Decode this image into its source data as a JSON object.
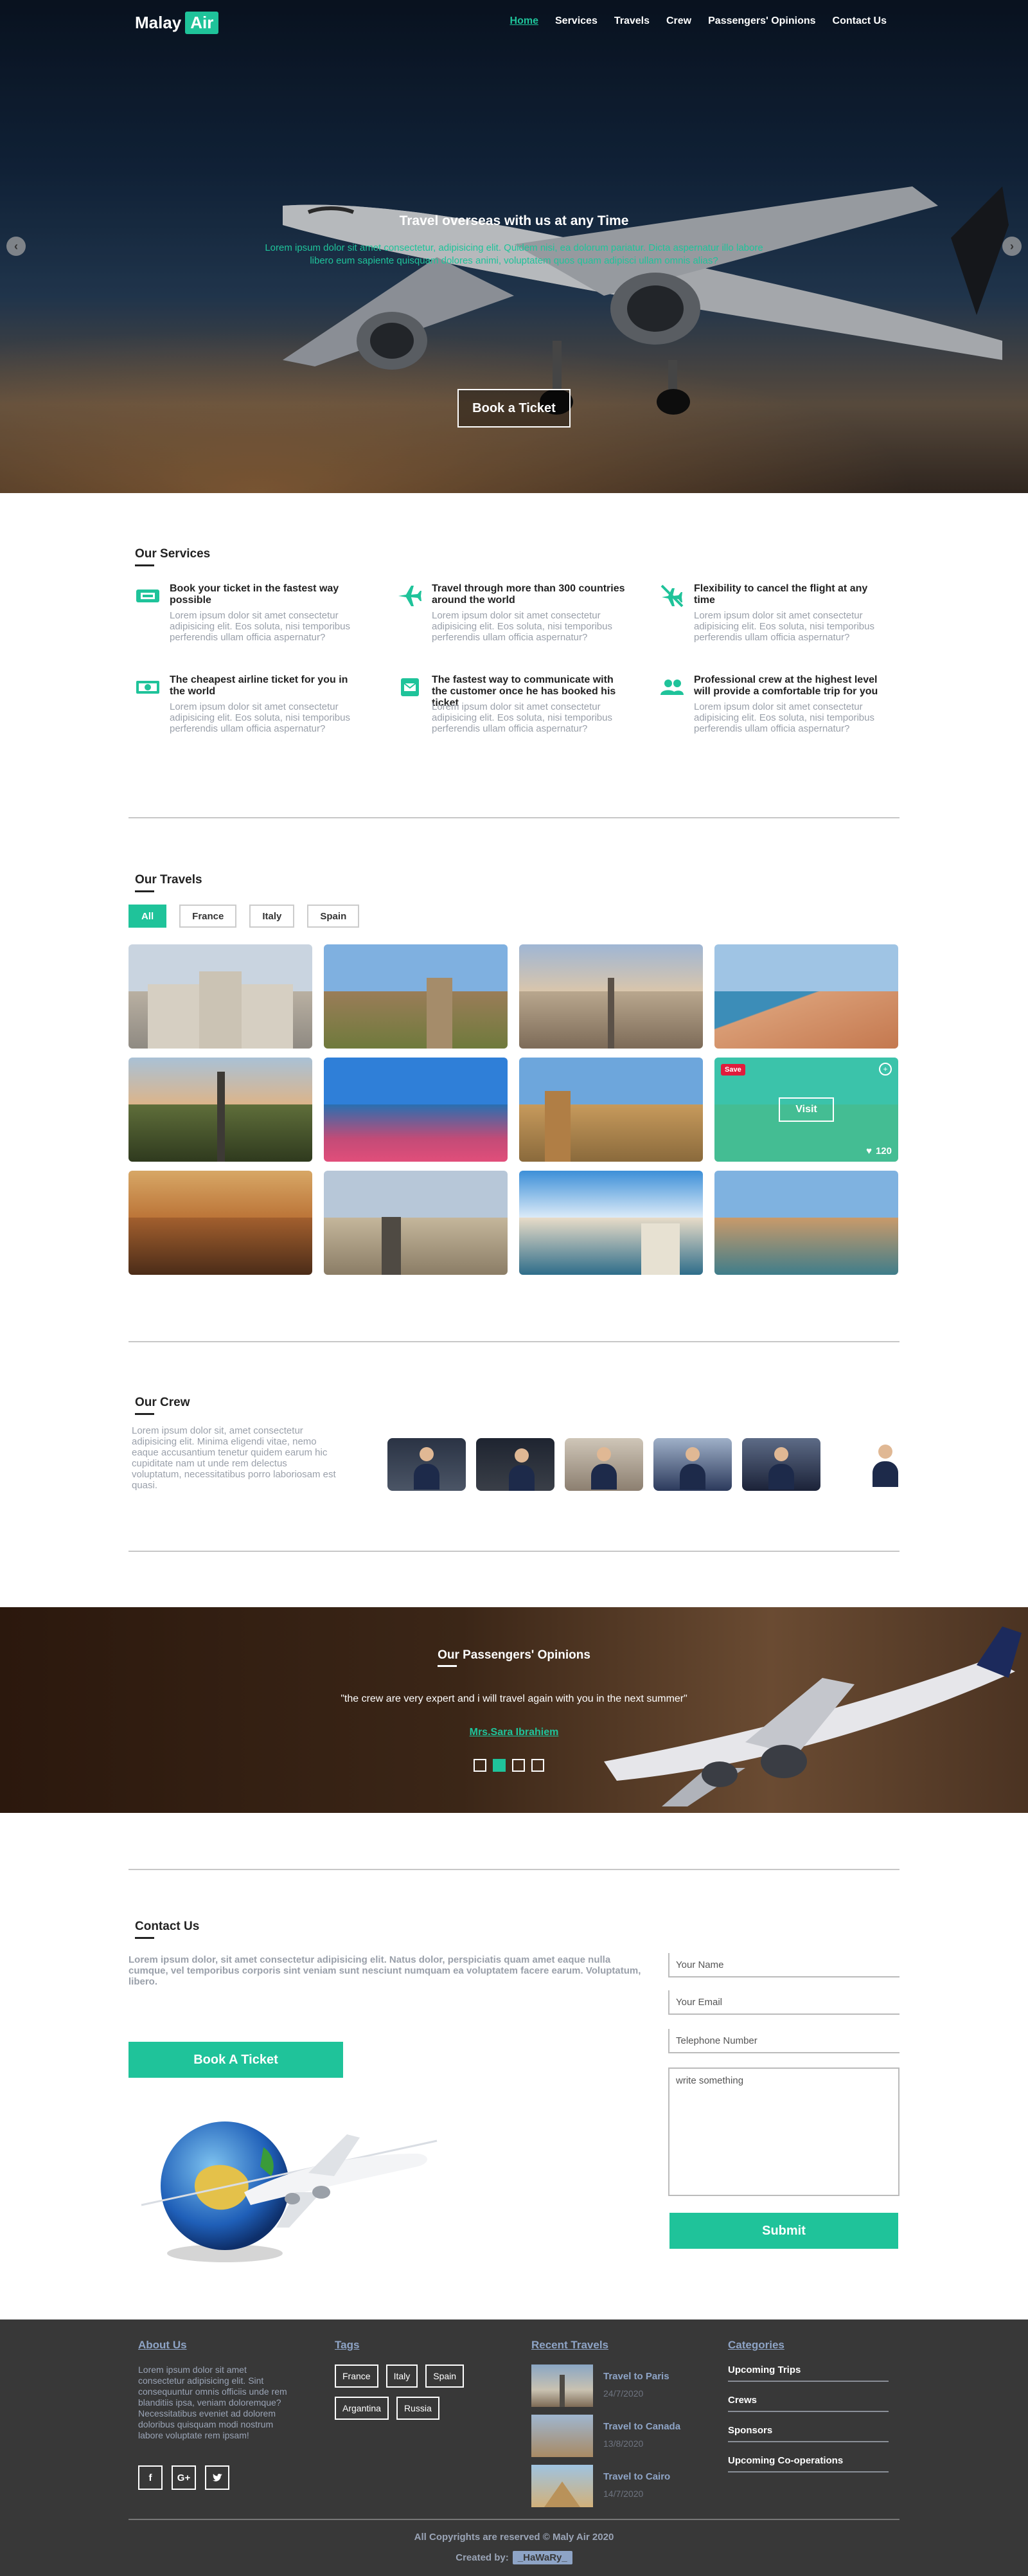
{
  "brand": {
    "name": "Malay",
    "accent": "Air",
    "accent_color": "#1fc39a"
  },
  "nav": [
    {
      "label": "Home",
      "active": true
    },
    {
      "label": "Services"
    },
    {
      "label": "Travels"
    },
    {
      "label": "Crew"
    },
    {
      "label": "Passengers' Opinions"
    },
    {
      "label": "Contact Us"
    }
  ],
  "hero": {
    "title": "Travel overseas with us at any Time",
    "text": "Lorem ipsum dolor sit amet consectetur, adipisicing elit. Quidem nisi, ea dolorum pariatur. Dicta aspernatur illo labore libero eum sapiente quisquam dolores animi, voluptatem quos quam adipisci ullam omnis alias?",
    "button": "Book a Ticket",
    "prev_icon": "chevron-left-icon",
    "next_icon": "chevron-right-icon"
  },
  "services": {
    "title": "Our Services",
    "items": [
      {
        "icon": "ticket-icon",
        "title": "Book your ticket in the fastest way possible",
        "text": "Lorem ipsum dolor sit amet consectetur adipisicing elit. Eos soluta, nisi temporibus perferendis ullam officia aspernatur?"
      },
      {
        "icon": "plane-icon",
        "title": "Travel through more than 300 countries around the world",
        "text": "Lorem ipsum dolor sit amet consectetur adipisicing elit. Eos soluta, nisi temporibus perferendis ullam officia aspernatur?"
      },
      {
        "icon": "plane-slash-icon",
        "title": "Flexibility to cancel the flight at any time",
        "text": "Lorem ipsum dolor sit amet consectetur adipisicing elit. Eos soluta, nisi temporibus perferendis ullam officia aspernatur?"
      },
      {
        "icon": "money-icon",
        "title": "The cheapest airline ticket for you in the world",
        "text": "Lorem ipsum dolor sit amet consectetur adipisicing elit. Eos soluta, nisi temporibus perferendis ullam officia aspernatur?"
      },
      {
        "icon": "envelope-icon",
        "title": "The fastest way to communicate with the customer once he has booked his ticket",
        "text": "Lorem ipsum dolor sit amet consectetur adipisicing elit. Eos soluta, nisi temporibus perferendis ullam officia aspernatur?"
      },
      {
        "icon": "users-icon",
        "title": "Professional crew at the highest level will provide a comfortable trip for you",
        "text": "Lorem ipsum dolor sit amet consectetur adipisicing elit. Eos soluta, nisi temporibus perferendis ullam officia aspernatur?"
      }
    ]
  },
  "travels": {
    "title": "Our Travels",
    "filters": [
      {
        "label": "All",
        "active": true
      },
      {
        "label": "France"
      },
      {
        "label": "Italy"
      },
      {
        "label": "Spain"
      }
    ],
    "hover_tile": {
      "save": "Save",
      "visit": "Visit",
      "likes": "120"
    }
  },
  "crew": {
    "title": "Our Crew",
    "text": "Lorem ipsum dolor sit, amet consectetur adipisicing elit. Minima eligendi vitae, nemo eaque accusantium tenetur quidem earum hic cupiditate nam ut unde rem delectus voluptatum, necessitatibus porro laboriosam est quasi."
  },
  "opinions": {
    "title": "Our Passengers' Opinions",
    "quote": "\"the crew are very expert and i will travel again with you in the next summer\"",
    "author": "Mrs.Sara Ibrahiem",
    "active_slide": 2,
    "slides": 4
  },
  "contact": {
    "title": "Contact Us",
    "text": "Lorem ipsum dolor, sit amet consectetur adipisicing elit. Natus dolor, perspiciatis quam amet eaque nulla cumque, vel temporibus corporis sint veniam sunt nesciunt numquam ea voluptatem facere earum. Voluptatum, libero.",
    "book_button": "Book A Ticket",
    "name_placeholder": "Your Name",
    "email_placeholder": "Your Email",
    "phone_placeholder": "Telephone Number",
    "message_placeholder": "write something",
    "submit": "Submit"
  },
  "footer": {
    "about": {
      "title": "About Us",
      "text": "Lorem ipsum dolor sit amet consectetur adipisicing elit. Sint consequuntur omnis officiis unde rem blanditiis ipsa, veniam doloremque? Necessitatibus eveniet ad dolorem doloribus quisquam modi nostrum labore voluptate rem ipsam!",
      "social": [
        "f",
        "G+",
        "t"
      ]
    },
    "tags": {
      "title": "Tags",
      "items": [
        "France",
        "Italy",
        "Spain",
        "Argantina",
        "Russia"
      ]
    },
    "recent": {
      "title": "Recent Travels",
      "items": [
        {
          "title": "Travel to Paris",
          "date": "24/7/2020"
        },
        {
          "title": "Travel to Canada",
          "date": "13/8/2020"
        },
        {
          "title": "Travel to Cairo",
          "date": "14/7/2020"
        }
      ]
    },
    "categories": {
      "title": "Categories",
      "items": [
        "Upcoming Trips",
        "Crews",
        "Sponsors",
        "Upcoming Co-operations"
      ]
    },
    "copyright": "All Copyrights are reserved © Maly Air 2020",
    "created_label": "Created by:",
    "created_by": "_HaWaRy_"
  }
}
